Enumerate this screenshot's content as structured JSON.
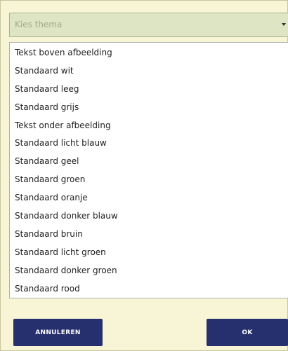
{
  "theme_select": {
    "placeholder": "Kies thema",
    "arrow_icon": "caret-down-icon"
  },
  "themes": [
    "Tekst boven afbeelding",
    "Standaard wit",
    "Standaard leeg",
    "Standaard grijs",
    "Tekst onder afbeelding",
    "Standaard licht blauw",
    "Standaard geel",
    "Standaard groen",
    "Standaard oranje",
    "Standaard donker blauw",
    "Standaard bruin",
    "Standaard licht groen",
    "Standaard donker groen",
    "Standaard rood"
  ],
  "buttons": {
    "cancel_label": "ANNULEREN",
    "ok_label": "OK"
  },
  "colors": {
    "dialog_background": "#f7f5d6",
    "select_background": "#dee5c4",
    "button_background": "#27306e",
    "button_text": "#ffffff"
  }
}
